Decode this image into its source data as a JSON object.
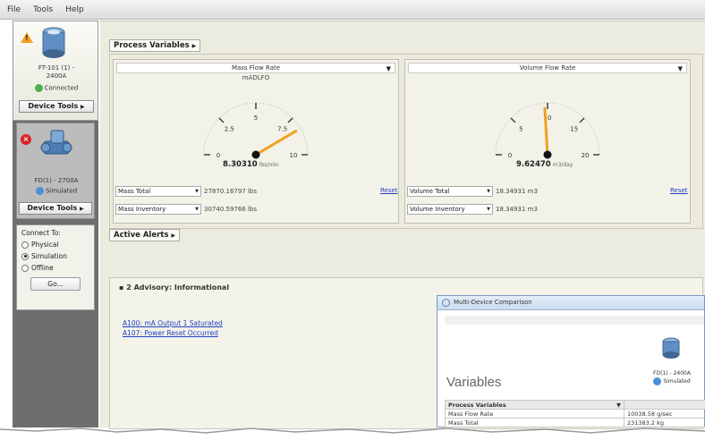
{
  "menu": {
    "items": [
      "File",
      "Tools",
      "Help"
    ]
  },
  "sidebar": {
    "device1": {
      "name_line1": "FT-101 (1) -",
      "name_line2": "2400A",
      "status": "Connected",
      "tools_label": "Device Tools"
    },
    "device2": {
      "name": "FD(1) - 2700A",
      "status": "Simulated",
      "tools_label": "Device Tools"
    },
    "connect": {
      "title": "Connect To:",
      "options": [
        "Physical",
        "Simulation",
        "Offline"
      ],
      "selected": "Simulation",
      "go_label": "Go..."
    }
  },
  "process_variables": {
    "title": "Process Variables",
    "gauge1": {
      "header": "Mass Flow Rate",
      "unit": "mADLFO",
      "value": "8.30310",
      "value_unit": "lbs/min",
      "scale_max": 10,
      "reading": 8.3031,
      "ticks": [
        "0",
        "2.5",
        "5",
        "7.5",
        "10"
      ],
      "row1_select": "Mass Total",
      "row1_value": "27870.16797 lbs",
      "row2_select": "Mass Inventory",
      "row2_value": "30740.59766 lbs",
      "reset_label": "Reset"
    },
    "gauge2": {
      "header": "Volume Flow Rate",
      "value": "9.62470",
      "value_unit": "m3/day",
      "scale_max": 20,
      "reading": 9.6247,
      "ticks": [
        "0",
        "5",
        "10",
        "15",
        "20"
      ],
      "row1_select": "Volume Total",
      "row1_value": "18.34931 m3",
      "row2_select": "Volume Inventory",
      "row2_value": "18.34931 m3",
      "reset_label": "Reset"
    }
  },
  "alerts": {
    "title": "Active Alerts",
    "group_label": "2 Advisory: Informational",
    "items": [
      "A100: mA Output 1 Saturated",
      "A107: Power Reset Occurred"
    ]
  },
  "popup": {
    "title": "Multi-Device Comparison",
    "heading": "Variables",
    "device_name": "FD(1) - 2400A",
    "device_status": "Simulated",
    "table_header": "Process Variables",
    "rows": [
      {
        "label": "Mass Flow Rate",
        "value": "10038.58 g/sec"
      },
      {
        "label": "Mass Total",
        "value": "231383.2 kg"
      }
    ]
  },
  "colors": {
    "needle": "#f0a020",
    "link": "#2140c0",
    "panel": "#f3f2e8"
  }
}
